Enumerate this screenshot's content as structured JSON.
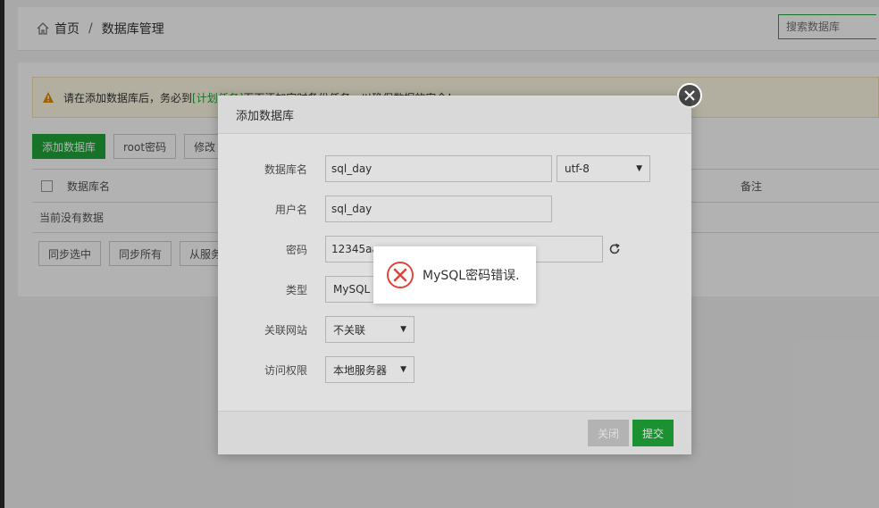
{
  "breadcrumb": {
    "home": "首页",
    "separator": "/",
    "current": "数据库管理"
  },
  "search": {
    "placeholder": "搜索数据库"
  },
  "alert": {
    "prefix": "请在添加数据库后，务必到",
    "link": "[计划任务]",
    "suffix": "页面添加定时备份任务，以确保数据的安全！"
  },
  "toolbar": {
    "add_db": "添加数据库",
    "root_pw": "root密码",
    "modify": "修改"
  },
  "table": {
    "col_name": "数据库名",
    "col_note": "备注",
    "empty": "当前没有数据"
  },
  "actions": {
    "sync_selected": "同步选中",
    "sync_all": "同步所有",
    "from_server": "从服务"
  },
  "modal": {
    "title": "添加数据库",
    "fields": {
      "db_name_label": "数据库名",
      "db_name_value": "sql_day",
      "charset_value": "utf-8",
      "user_label": "用户名",
      "user_value": "sql_day",
      "password_label": "密码",
      "password_value": "12345aa",
      "type_label": "类型",
      "type_value": "MySQL",
      "site_label": "关联网站",
      "site_value": "不关联",
      "access_label": "访问权限",
      "access_value": "本地服务器"
    },
    "close_btn": "关闭",
    "submit_btn": "提交"
  },
  "toast": {
    "message": "MySQL密码错误."
  },
  "colors": {
    "accent": "#20a53a",
    "error": "#e0453a"
  }
}
